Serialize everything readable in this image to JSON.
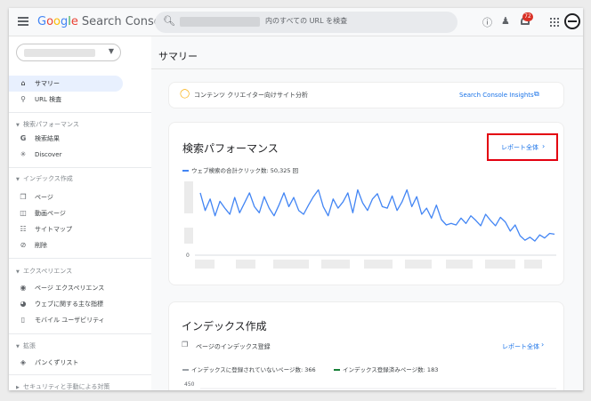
{
  "app": {
    "logo_google": [
      "G",
      "o",
      "o",
      "g",
      "l",
      "e"
    ],
    "logo_product": "Search Console"
  },
  "search": {
    "placeholder": "内のすべての URL を検査"
  },
  "topbar": {
    "notification_count": "72"
  },
  "sidebar": {
    "items": {
      "summary": "サマリー",
      "url_inspect": "URL 検査",
      "search_results": "検索結果",
      "discover": "Discover",
      "pages": "ページ",
      "video_pages": "動画ページ",
      "sitemaps": "サイトマップ",
      "removals": "削除",
      "page_experience": "ページ エクスペリエンス",
      "web_vitals": "ウェブに関する主な指標",
      "mobile_usability": "モバイル ユーザビリティ",
      "breadcrumbs": "パンくずリスト"
    },
    "sections": {
      "search_performance": "検索パフォーマンス",
      "indexing": "インデックス作成",
      "experience": "エクスペリエンス",
      "enhancements": "拡張",
      "security": "セキュリティと手動による対策"
    }
  },
  "main": {
    "page_title": "サマリー",
    "insights": {
      "text": "コンテンツ クリエイター向けサイト分析",
      "link": "Search Console Insights"
    },
    "performance": {
      "title": "検索パフォーマンス",
      "report_link": "レポート全体",
      "legend": "ウェブ検索の合計クリック数: 50,325 回",
      "zero_label": "0"
    },
    "indexing": {
      "title": "インデックス作成",
      "subtitle": "ページのインデックス登録",
      "report_link": "レポート全体",
      "legend_not_indexed": "インデックスに登録されていないページ数: 366",
      "legend_indexed": "インデックス登録済みページ数: 183",
      "y_top_label": "450"
    }
  },
  "colors": {
    "accent": "#1a73e8",
    "highlight": "#e3000f",
    "clicks_line": "#4285f4",
    "not_indexed": "#9aa0a6",
    "indexed": "#188038"
  },
  "chart_data": [
    {
      "type": "line",
      "series": [
        {
          "name": "ウェブ検索の合計クリック数",
          "values": [
            0.78,
            0.55,
            0.7,
            0.48,
            0.67,
            0.58,
            0.5,
            0.72,
            0.52,
            0.65,
            0.78,
            0.6,
            0.52,
            0.73,
            0.58,
            0.48,
            0.62,
            0.78,
            0.6,
            0.72,
            0.55,
            0.5,
            0.62,
            0.73,
            0.82,
            0.6,
            0.48,
            0.7,
            0.58,
            0.66,
            0.78,
            0.52,
            0.82,
            0.65,
            0.55,
            0.7,
            0.77,
            0.6,
            0.58,
            0.74,
            0.55,
            0.66,
            0.82,
            0.6,
            0.73,
            0.5,
            0.58,
            0.45,
            0.62,
            0.43,
            0.36,
            0.38,
            0.36,
            0.45,
            0.38,
            0.48,
            0.42,
            0.35,
            0.5,
            0.42,
            0.35,
            0.46,
            0.4,
            0.28,
            0.36,
            0.22,
            0.16,
            0.2,
            0.15,
            0.23,
            0.19,
            0.25,
            0.24
          ]
        }
      ],
      "ylabel": "",
      "xlabel": ""
    }
  ]
}
